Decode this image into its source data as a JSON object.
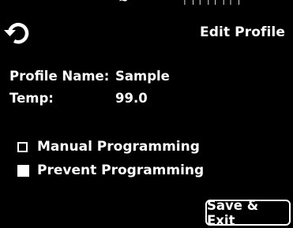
{
  "header": {
    "back_icon": "undo-arrow-icon",
    "title": "Edit Profile"
  },
  "profile": {
    "name_label": "Profile Name:",
    "name_value": "Sample",
    "temp_label": "Temp:",
    "temp_value": "99.0"
  },
  "options": [
    {
      "label": "Manual Programming",
      "checked": false
    },
    {
      "label": "Prevent Programming",
      "checked": true
    }
  ],
  "footer": {
    "save_label": "Save & Exit"
  },
  "colors": {
    "background": "#000000",
    "foreground": "#ffffff"
  }
}
